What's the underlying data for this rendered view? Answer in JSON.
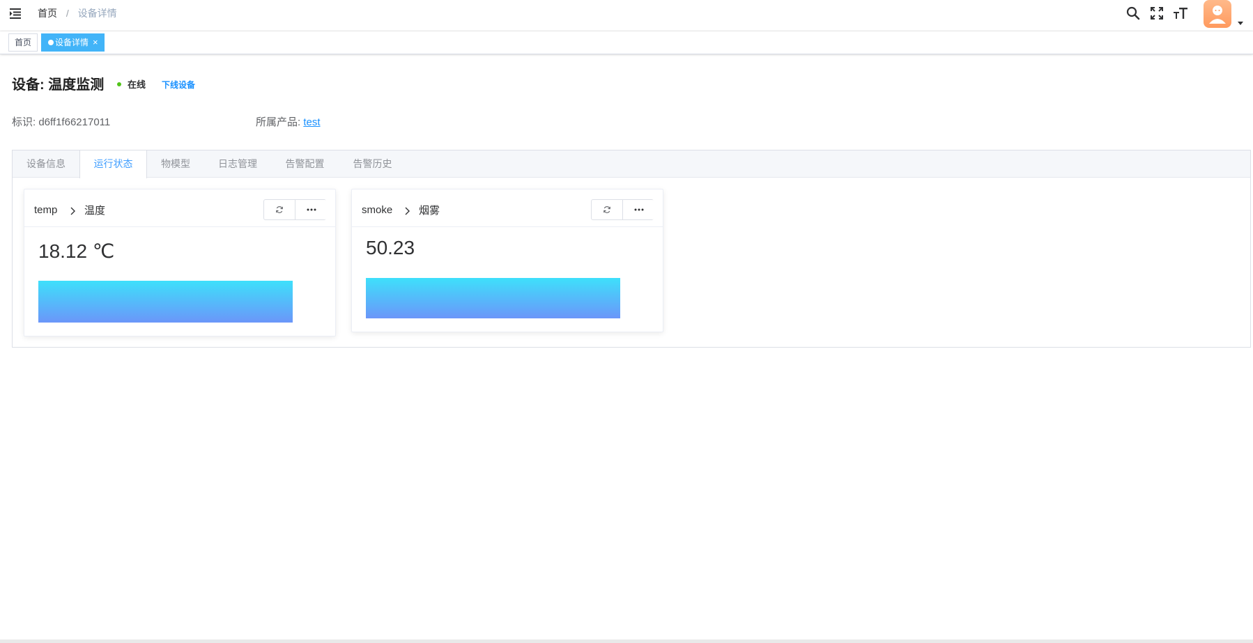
{
  "navbar": {
    "breadcrumb": {
      "home": "首页",
      "separator": "/",
      "current": "设备详情"
    },
    "icons": [
      "menu-fold-icon",
      "search-icon",
      "fullscreen-icon",
      "font-size-icon",
      "avatar",
      "caret-down-icon"
    ]
  },
  "tags_view": {
    "home": "首页",
    "active": "设备详情",
    "close": "×"
  },
  "device": {
    "title": "设备: 温度监测",
    "status": "在线",
    "status_color": "#52c41a",
    "offline_action": "下线设备",
    "id_label": "标识: ",
    "id_value": "d6ff1f66217011",
    "product_label": "所属产品: ",
    "product_value": "test"
  },
  "tabs": [
    {
      "label": "设备信息",
      "active": false
    },
    {
      "label": "运行状态",
      "active": true
    },
    {
      "label": "物模型",
      "active": false
    },
    {
      "label": "日志管理",
      "active": false
    },
    {
      "label": "告警配置",
      "active": false
    },
    {
      "label": "告警历史",
      "active": false
    }
  ],
  "cards": [
    {
      "property": "temp",
      "name": "温度",
      "value": "18.12 ℃"
    },
    {
      "property": "smoke",
      "name": "烟雾",
      "value": "50.23"
    }
  ],
  "colors": {
    "accent": "#409eff",
    "link": "#1890ff",
    "tag_active": "#42b4f8",
    "bar_top": "#3ee0fb",
    "bar_bottom": "#6b96f9"
  }
}
